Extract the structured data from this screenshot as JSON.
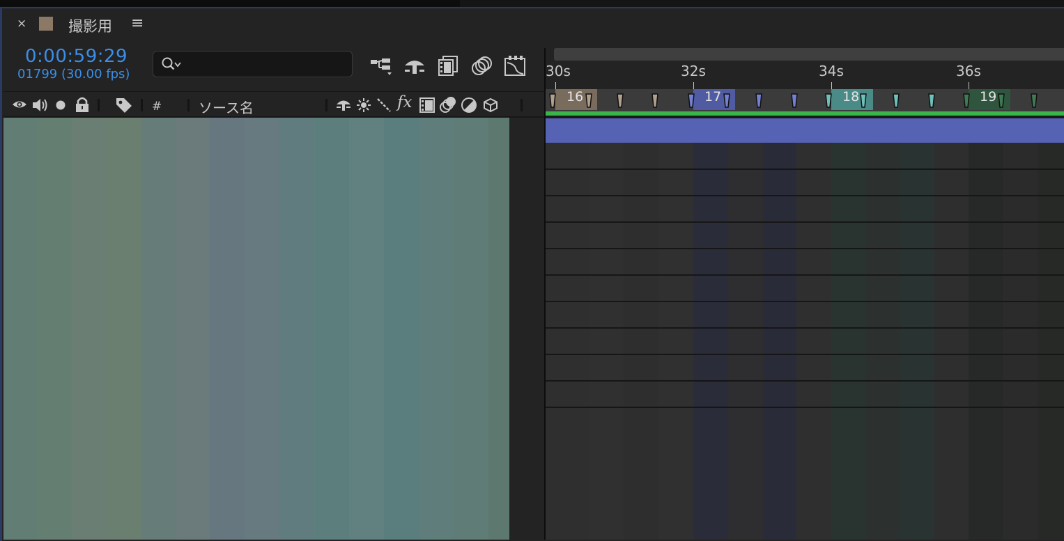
{
  "tab": {
    "close_label": "×",
    "swatch_color": "#8b7966",
    "title": "撮影用",
    "menu_icon": "hamburger-icon",
    "menu_label": "≡"
  },
  "time": {
    "timecode": "0:00:59:29",
    "frames": "01799 (30.00 fps)",
    "accent_color": "#3b8ee8"
  },
  "search": {
    "icon": "search-icon",
    "value": "",
    "placeholder": ""
  },
  "toolbar": [
    {
      "icon": "composition-flowchart-icon"
    },
    {
      "icon": "shy-layers-icon"
    },
    {
      "icon": "frame-blending-icon"
    },
    {
      "icon": "motion-blur-icon"
    },
    {
      "icon": "graph-editor-icon"
    }
  ],
  "columns": {
    "switch_icons": [
      "eye-icon",
      "audio-icon",
      "solo-icon",
      "lock-icon",
      "label-tag-icon"
    ],
    "number_label": "#",
    "source_name_label": "ソース名",
    "layer_switch_icons": [
      "shy-icon",
      "collapse-icon",
      "quality-icon",
      "effects-icon",
      "frame-blend-icon",
      "motion-blur-icon",
      "adjustment-layer-icon",
      "3d-layer-icon"
    ],
    "effects_label": "fx"
  },
  "ruler": {
    "labels": [
      "30s",
      "32s",
      "34s",
      "36s"
    ]
  },
  "markers": [
    {
      "label": "16",
      "color": "#8b7966"
    },
    {
      "label": "17",
      "color": "#5662b4"
    },
    {
      "label": "18",
      "color": "#4e9a95"
    },
    {
      "label": "19",
      "color": "#2f5a3f"
    }
  ],
  "colors": {
    "layer_bar": "#5662b4",
    "work_area": "#3ab54a",
    "panel_border": "#2b3a63"
  }
}
